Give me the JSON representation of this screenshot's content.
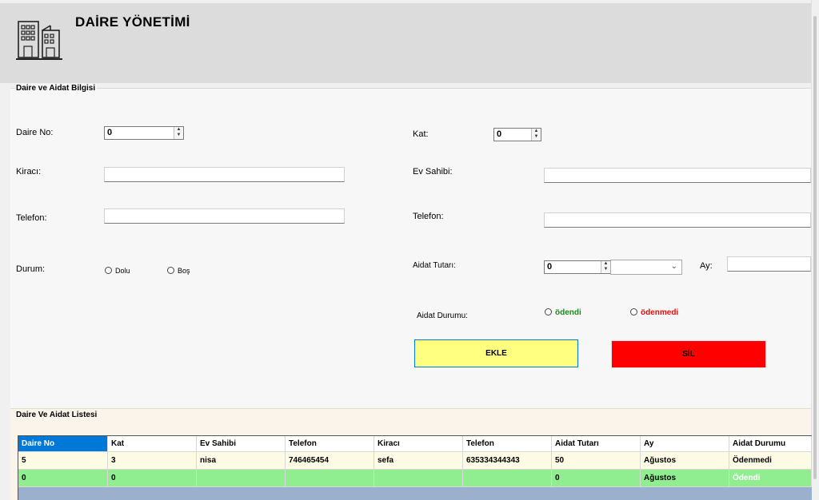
{
  "header": {
    "title": "DAİRE YÖNETİMİ",
    "icon": "building-icon"
  },
  "info_group": {
    "label": "Daire ve Aidat Bilgisi",
    "daire_no": {
      "label": "Daire No:",
      "value": "0"
    },
    "kat": {
      "label": "Kat:",
      "value": "0"
    },
    "kiraci": {
      "label": "Kiracı:",
      "value": ""
    },
    "ev_sahibi": {
      "label": "Ev Sahibi:",
      "value": ""
    },
    "telefon_left": {
      "label": "Telefon:",
      "value": ""
    },
    "telefon_right": {
      "label": "Telefon:",
      "value": ""
    },
    "durum": {
      "label": "Durum:",
      "options": [
        "Dolu",
        "Boş"
      ]
    },
    "aidat_tutari": {
      "label": "Aidat Tutarı:",
      "value": "0",
      "combo_value": ""
    },
    "ay": {
      "label": "Ay:",
      "value": ""
    },
    "aidat_durumu": {
      "label": "Aidat Durumu:",
      "options": [
        "ödendi",
        "ödenmedi"
      ],
      "colors": [
        "#1a8a1a",
        "#e01010"
      ]
    },
    "buttons": {
      "add": "EKLE",
      "delete": "SİL",
      "add_color": "#ffff80",
      "delete_color": "#ff0000"
    }
  },
  "list_group": {
    "label": "Daire Ve Aidat Listesi",
    "columns": [
      "Daire No",
      "Kat",
      "Ev Sahibi",
      "Telefon",
      "Kiracı",
      "Telefon",
      "Aidat Tutarı",
      "Ay",
      "Aidat Durumu"
    ],
    "rows": [
      {
        "cells": [
          "5",
          "3",
          "nisa",
          "746465454",
          "sefa",
          "635334344343",
          "50",
          "Ağustos",
          "Ödenmedi"
        ],
        "bg": "#fdfbe3"
      },
      {
        "cells": [
          "0",
          "0",
          "",
          "",
          "",
          "",
          "0",
          "Ağustos",
          "Ödendi"
        ],
        "bg": "#90ee90"
      }
    ]
  }
}
